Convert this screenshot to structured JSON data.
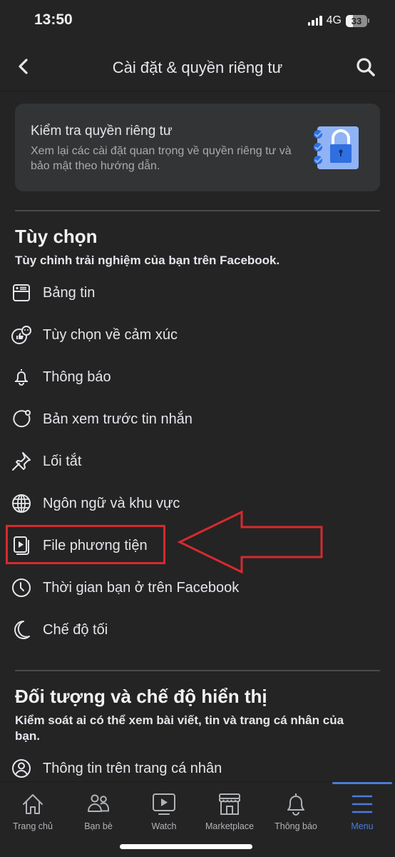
{
  "status_bar": {
    "time": "13:50",
    "network": "4G",
    "battery": "33",
    "battery_percent": 33
  },
  "nav": {
    "title": "Cài đặt & quyền riêng tư",
    "back_icon": "chevron-left-icon",
    "search_icon": "search-icon"
  },
  "privacy_card": {
    "title": "Kiểm tra quyền riêng tư",
    "description": "Xem lại các cài đặt quan trọng về quyền riêng tư và bảo mật theo hướng dẫn.",
    "icon": "privacy-checklist-lock-icon"
  },
  "sections": [
    {
      "title": "Tùy chọn",
      "subtitle": "Tùy chỉnh trải nghiệm của bạn trên Facebook.",
      "items": [
        {
          "label": "Bảng tin",
          "icon": "news-feed-icon"
        },
        {
          "label": "Tùy chọn về cảm xúc",
          "icon": "reaction-preferences-icon"
        },
        {
          "label": "Thông báo",
          "icon": "bell-icon"
        },
        {
          "label": "Bản xem trước tin nhắn",
          "icon": "message-preview-icon"
        },
        {
          "label": "Lối tắt",
          "icon": "pin-icon"
        },
        {
          "label": "Ngôn ngữ và khu vực",
          "icon": "globe-icon"
        },
        {
          "label": "File phương tiện",
          "icon": "media-files-icon"
        },
        {
          "label": "Thời gian bạn ở trên Facebook",
          "icon": "clock-icon"
        },
        {
          "label": "Chế độ tối",
          "icon": "moon-icon"
        }
      ]
    },
    {
      "title": "Đối tượng và chế độ hiển thị",
      "subtitle": "Kiểm soát ai có thể xem bài viết, tin và trang cá nhân của bạn.",
      "items": [
        {
          "label": "Thông tin trên trang cá nhân",
          "icon": "profile-icon"
        }
      ]
    }
  ],
  "annotation": {
    "highlighted_item": "File phương tiện",
    "color": "#d62a2f"
  },
  "tabbar": {
    "tabs": [
      {
        "label": "Trang chủ",
        "icon": "home-icon"
      },
      {
        "label": "Bạn bè",
        "icon": "friends-icon"
      },
      {
        "label": "Watch",
        "icon": "watch-icon"
      },
      {
        "label": "Marketplace",
        "icon": "marketplace-icon"
      },
      {
        "label": "Thông báo",
        "icon": "bell-icon"
      },
      {
        "label": "Menu",
        "icon": "menu-icon"
      }
    ],
    "active": "Menu",
    "active_color": "#4c7bd9"
  }
}
